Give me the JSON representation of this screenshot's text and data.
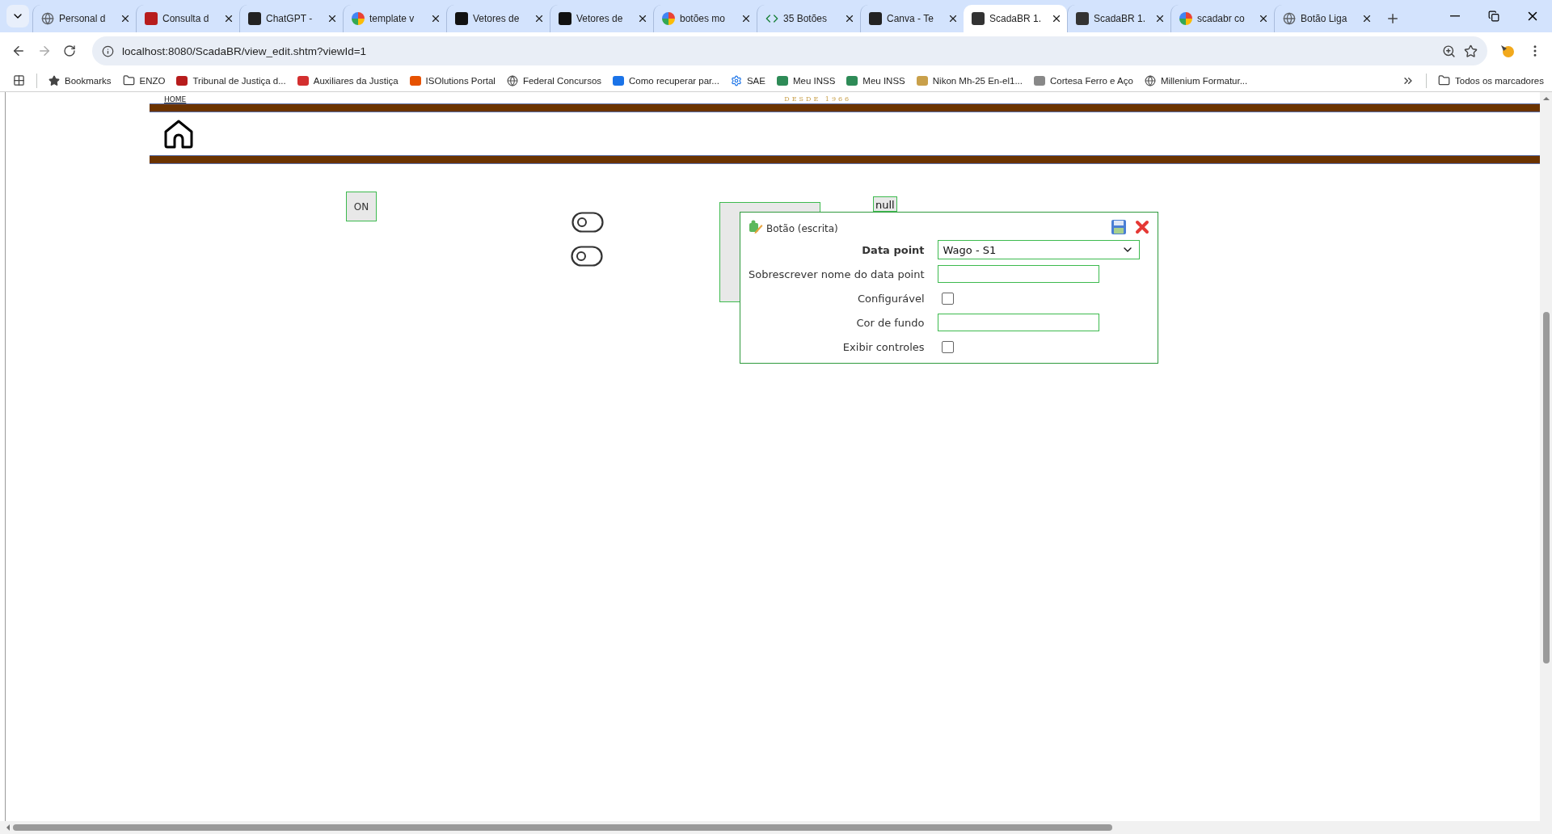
{
  "browser": {
    "tabs": [
      {
        "title": "Personal d",
        "selected": false
      },
      {
        "title": "Consulta d",
        "selected": false
      },
      {
        "title": "ChatGPT -",
        "selected": false
      },
      {
        "title": "template v",
        "selected": false
      },
      {
        "title": "Vetores de",
        "selected": false
      },
      {
        "title": "Vetores de",
        "selected": false
      },
      {
        "title": "botões mo",
        "selected": false
      },
      {
        "title": "35 Botões",
        "selected": false
      },
      {
        "title": "Canva - Te",
        "selected": false
      },
      {
        "title": "ScadaBR 1.",
        "selected": true
      },
      {
        "title": "ScadaBR 1.",
        "selected": false
      },
      {
        "title": "scadabr co",
        "selected": false
      },
      {
        "title": "Botão Liga",
        "selected": false
      }
    ],
    "address": "localhost:8080/ScadaBR/view_edit.shtm?viewId=1",
    "bookmarks": [
      "Bookmarks",
      "ENZO",
      "Tribunal de Justiça d...",
      "Auxiliares da Justiça",
      "ISOlutions Portal",
      "Federal Concursos",
      "Como recuperar par...",
      "SAE",
      "Meu INSS",
      "Meu INSS",
      "Nikon Mh-25 En-el1...",
      "Cortesa Ferro e Aço",
      "Millenium Formatur..."
    ],
    "all_bookmarks": "Todos os marcadores"
  },
  "page": {
    "home_link": "HOME",
    "tagline": "DESDE 1966",
    "widgets": [
      {
        "kind": "button",
        "label": "ON"
      },
      {
        "kind": "toggle",
        "on": false
      },
      {
        "kind": "toggle",
        "on": false
      },
      {
        "kind": "box"
      },
      {
        "kind": "value",
        "label": "null"
      }
    ],
    "dialog": {
      "title": "Botão (escrita)",
      "fields": [
        {
          "kind": "select",
          "label": "Data point",
          "value": "Wago - S1"
        },
        {
          "kind": "text",
          "label": "Sobrescrever nome do data point"
        },
        {
          "kind": "checkbox",
          "label": "Configurável",
          "checked": false
        },
        {
          "kind": "text",
          "label": "Cor de fundo"
        },
        {
          "kind": "checkbox",
          "label": "Exibir controles",
          "checked": false
        }
      ]
    }
  }
}
